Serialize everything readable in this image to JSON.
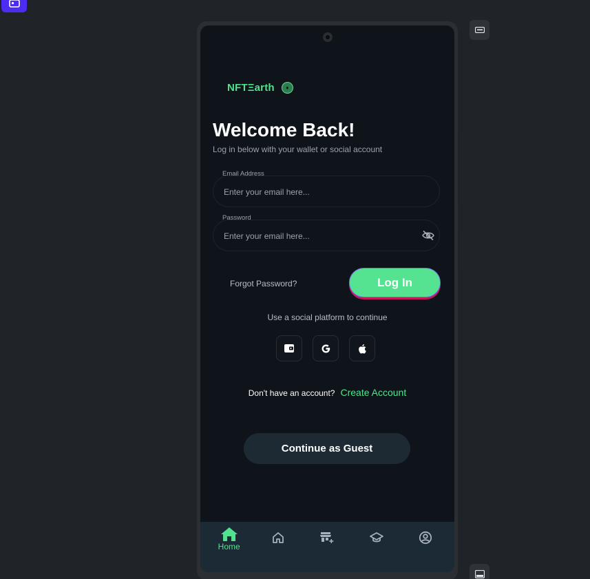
{
  "app": {
    "logo_text": "NFTΞarth",
    "title": "Welcome Back!",
    "subtitle": "Log in below with your wallet or social account"
  },
  "form": {
    "email_label": "Email Address",
    "email_placeholder": "Enter your email here...",
    "password_label": "Password",
    "password_placeholder": "Enter your email here...",
    "forgot_label": "Forgot Password?",
    "login_label": "Log In"
  },
  "social": {
    "label": "Use a social platform to continue",
    "buttons": [
      {
        "icon": "wallet-icon"
      },
      {
        "icon": "google-icon"
      },
      {
        "icon": "apple-icon"
      }
    ]
  },
  "signup": {
    "text": "Don't have an account?",
    "link": "Create Account"
  },
  "guest": {
    "label": "Continue as Guest"
  },
  "nav": {
    "items": [
      {
        "icon": "home-icon",
        "label": "Home",
        "active": true
      },
      {
        "icon": "house-outline-icon",
        "label": "",
        "active": false
      },
      {
        "icon": "marketplace-icon",
        "label": "",
        "active": false
      },
      {
        "icon": "graduation-cap-icon",
        "label": "",
        "active": false
      },
      {
        "icon": "profile-icon",
        "label": "",
        "active": false
      }
    ]
  },
  "colors": {
    "accent": "#52e28f",
    "background": "#0f141a",
    "nav_background": "#1c2a35"
  }
}
